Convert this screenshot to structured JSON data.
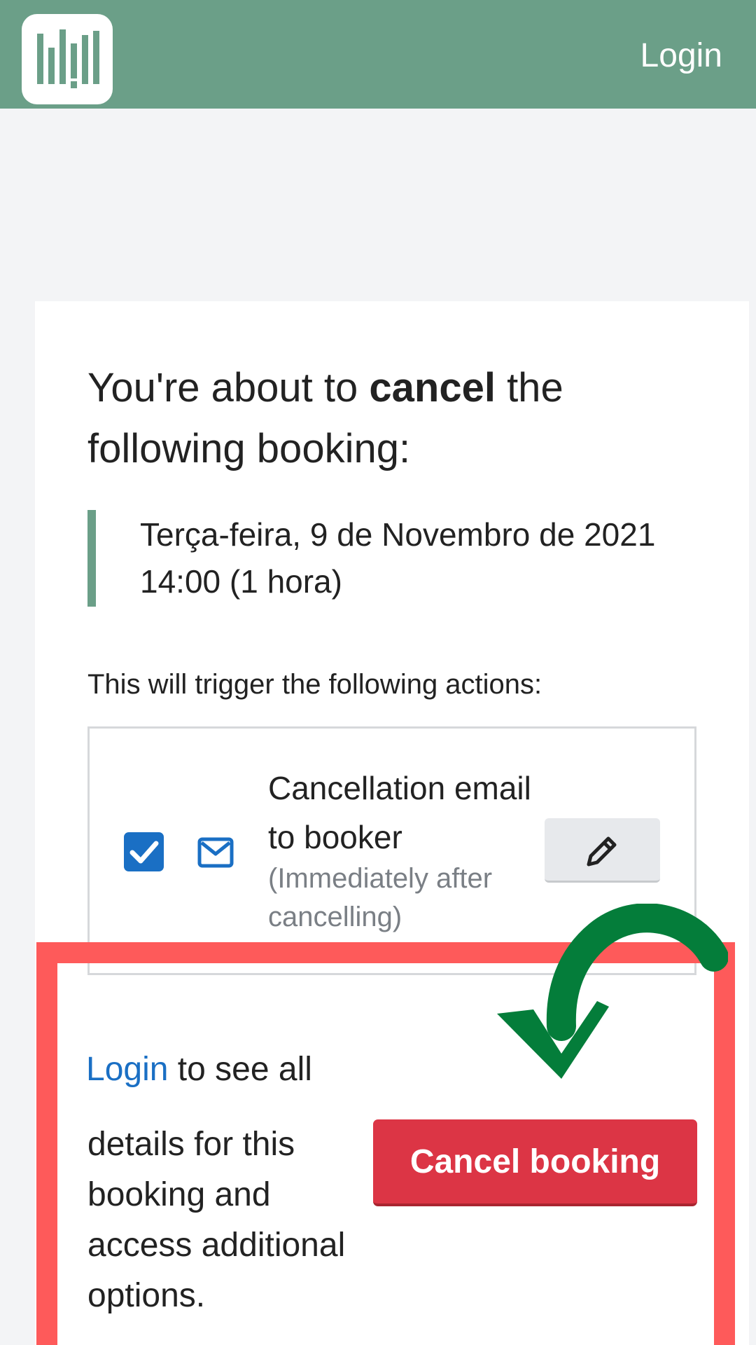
{
  "header": {
    "login_label": "Login"
  },
  "heading": {
    "prefix": "You're about to ",
    "emphasis": "cancel",
    "suffix": " the following booking:"
  },
  "booking": {
    "date": "Terça-feira, 9 de Novembro de 2021",
    "time": "14:00 (1 hora)"
  },
  "actions": {
    "intro": "This will trigger the following actions:",
    "items": [
      {
        "checked": true,
        "icon": "mail-icon",
        "title": "Cancellation email to booker",
        "subtitle": "(Immediately after cancelling)",
        "edit_icon": "pencil-icon"
      }
    ]
  },
  "footer": {
    "login_link": "Login",
    "login_suffix": " to see all",
    "login_rest": "details for this booking and access additional options.",
    "cancel_button": "Cancel booking"
  },
  "colors": {
    "header": "#6b9f88",
    "link": "#1a6fc4",
    "danger": "#dc3545",
    "highlight": "#fe5a5a",
    "annotation_arrow": "#047d3a"
  }
}
